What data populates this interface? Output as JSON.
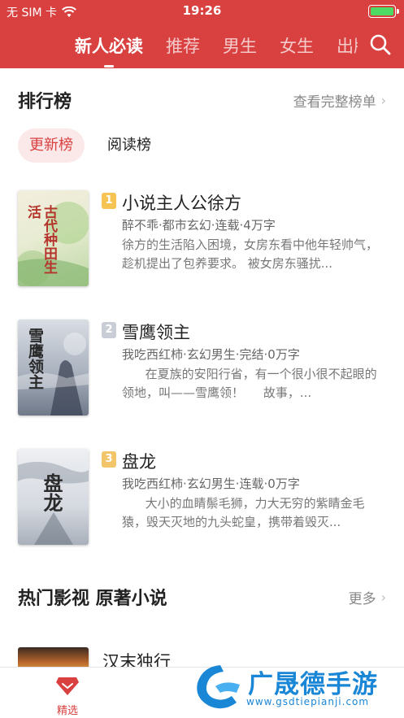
{
  "status": {
    "carrier": "无 SIM 卡",
    "time": "19:26",
    "battery_level": 1.0
  },
  "nav": {
    "tabs": [
      "新人必读",
      "推荐",
      "男生",
      "女生",
      "出版"
    ],
    "active_index": 0
  },
  "ranking": {
    "title": "排行榜",
    "more": "查看完整榜单",
    "chips": [
      "更新榜",
      "阅读榜"
    ],
    "books": [
      {
        "rank": "1",
        "title": "小说主人公徐方",
        "meta": "醉不乖·都市玄幻·连载·4万字",
        "desc": "徐方的生活陷入困境，女房东看中他年轻帅气，趁机提出了包养要求。 被女房东骚扰...",
        "cover_text": "古代种田生活"
      },
      {
        "rank": "2",
        "title": "雪鹰领主",
        "meta": "我吃西红柿·玄幻男生·完结·0万字",
        "desc": "      在夏族的安阳行省，有一个很小很不起眼的领地，叫——雪鹰领！     故事，...",
        "cover_text": "雪鹰领主"
      },
      {
        "rank": "3",
        "title": "盘龙",
        "meta": "我吃西红柿·玄幻男生·连载·0万字",
        "desc": "      大小的血睛鬃毛狮，力大无穷的紫睛金毛猿，毁天灭地的九头蛇皇，携带着毁灭...",
        "cover_text": "盘龙"
      }
    ]
  },
  "film": {
    "title": "热门影视 原著小说",
    "more": "更多",
    "first_book_title": "汉末独行"
  },
  "bottom_nav": {
    "label": "精选"
  },
  "watermark": {
    "name": "广晟德手游",
    "url": "www.gsdtiepianji.com"
  },
  "colors": {
    "primary": "#d94141",
    "rank_gold": "#f6c453",
    "rank_silver": "#c9cdd6"
  }
}
